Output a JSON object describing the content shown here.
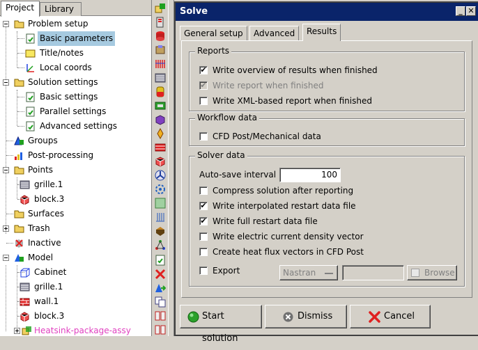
{
  "left_tabs": [
    "Project",
    "Library"
  ],
  "tree": [
    {
      "label": "Problem setup",
      "icon": "folder-icon"
    },
    {
      "label": "Basic parameters",
      "icon": "document-green-icon",
      "selected": true
    },
    {
      "label": "Title/notes",
      "icon": "note-icon"
    },
    {
      "label": "Local coords",
      "icon": "axes-icon"
    },
    {
      "label": "Solution settings",
      "icon": "folder-icon"
    },
    {
      "label": "Basic settings",
      "icon": "document-green-icon"
    },
    {
      "label": "Parallel settings",
      "icon": "document-green-icon"
    },
    {
      "label": "Advanced settings",
      "icon": "document-green-icon"
    },
    {
      "label": "Groups",
      "icon": "groups-icon"
    },
    {
      "label": "Post-processing",
      "icon": "post-processing-icon"
    },
    {
      "label": "Points",
      "icon": "folder-icon"
    },
    {
      "label": "grille.1",
      "icon": "grille-icon"
    },
    {
      "label": "block.3",
      "icon": "block-icon"
    },
    {
      "label": "Surfaces",
      "icon": "folder-icon"
    },
    {
      "label": "Trash",
      "icon": "trash-folder-icon"
    },
    {
      "label": "Inactive",
      "icon": "inactive-icon"
    },
    {
      "label": "Model",
      "icon": "model-icon"
    },
    {
      "label": "Cabinet",
      "icon": "cabinet-icon"
    },
    {
      "label": "grille.1",
      "icon": "grille-icon"
    },
    {
      "label": "wall.1",
      "icon": "wall-icon"
    },
    {
      "label": "block.3",
      "icon": "block-icon"
    },
    {
      "label": "Heatsink-package-assy",
      "icon": "assembly-icon",
      "pink": true
    }
  ],
  "dialog": {
    "title": "Solve",
    "tabs": [
      "General setup",
      "Advanced",
      "Results"
    ],
    "active_tab": "Results",
    "reports": {
      "title": "Reports",
      "items": [
        {
          "label": "Write overview of results when finished",
          "checked": true,
          "enabled": true
        },
        {
          "label": "Write report when finished",
          "checked": true,
          "enabled": false
        },
        {
          "label": "Write XML-based report when finished",
          "checked": false,
          "enabled": true
        }
      ]
    },
    "workflow": {
      "title": "Workflow data",
      "items": [
        {
          "label": "CFD Post/Mechanical data",
          "checked": false,
          "enabled": true
        }
      ]
    },
    "solver": {
      "title": "Solver data",
      "autosave_label": "Auto-save interval",
      "autosave_value": "100",
      "items": [
        {
          "label": "Compress solution after reporting",
          "checked": false
        },
        {
          "label": "Write interpolated restart data file",
          "checked": true
        },
        {
          "label": "Write full restart data file",
          "checked": true
        },
        {
          "label": "Write electric current density vector",
          "checked": false
        },
        {
          "label": "Create heat flux vectors in CFD Post",
          "checked": false
        }
      ],
      "export_label": "Export",
      "export_checked": false,
      "export_format": "Nastran",
      "export_path": "",
      "browse_label": "Browse"
    },
    "buttons": {
      "start": "Start solution",
      "dismiss": "Dismiss",
      "cancel": "Cancel"
    }
  },
  "colors": {
    "titlebar": "#0a246a",
    "selection": "#a6cae0",
    "pink_text": "#e040c0",
    "start_green": "#2aa02a",
    "cancel_red": "#e02020"
  }
}
